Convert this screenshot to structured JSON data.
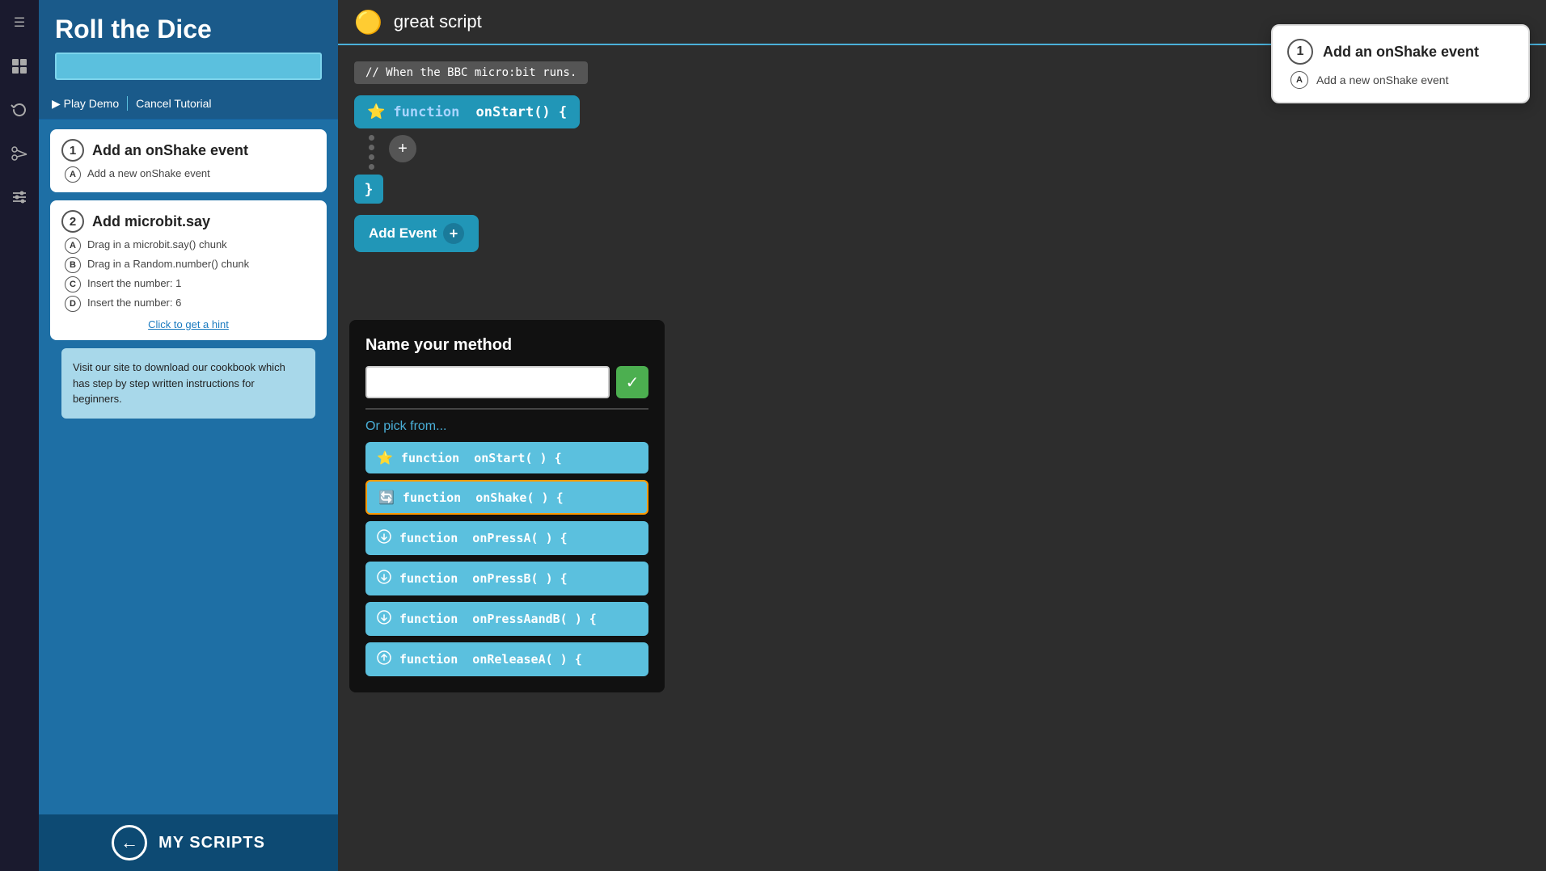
{
  "app": {
    "title": "Roll the Dice"
  },
  "icon_bar": {
    "items": [
      {
        "name": "menu-icon",
        "symbol": "☰"
      },
      {
        "name": "blocks-icon",
        "symbol": "⬛"
      },
      {
        "name": "refresh-icon",
        "symbol": "↻"
      },
      {
        "name": "scissors-icon",
        "symbol": "✂"
      },
      {
        "name": "sliders-icon",
        "symbol": "⚙"
      }
    ]
  },
  "sidebar": {
    "title": "Roll the Dice",
    "search_placeholder": "",
    "play_demo_label": "▶ Play Demo",
    "cancel_tutorial_label": "Cancel Tutorial",
    "steps": [
      {
        "number": "1",
        "title": "Add an onShake event",
        "sub_steps": [
          {
            "label": "A",
            "text": "Add a new onShake event"
          }
        ]
      },
      {
        "number": "2",
        "title": "Add microbit.say",
        "sub_steps": [
          {
            "label": "A",
            "text": "Drag in a microbit.say() chunk"
          },
          {
            "label": "B",
            "text": "Drag in a Random.number() chunk"
          },
          {
            "label": "C",
            "text": "Insert the number: 1"
          },
          {
            "label": "D",
            "text": "Insert the number: 6"
          }
        ],
        "hint": "Click to get a hint"
      }
    ],
    "info_box_text": "Visit our site to download our cookbook which has step by step written instructions for beginners.",
    "my_scripts_label": "MY SCRIPTS"
  },
  "top_bar": {
    "script_icon": "🟡",
    "script_name": "great script"
  },
  "code_area": {
    "comment": "// When the BBC micro:bit runs.",
    "function_start": "function onStart() {",
    "function_keyword": "function",
    "function_name": "onStart",
    "closing_brace": "}",
    "add_event_label": "Add Event",
    "add_event_plus": "+"
  },
  "method_modal": {
    "title": "Name your method",
    "input_placeholder": "",
    "confirm_checkmark": "✓",
    "or_pick_label": "Or pick from...",
    "options": [
      {
        "icon": "⭐",
        "text": "function  onStart( ) {",
        "highlighted": false
      },
      {
        "icon": "🔄",
        "text": "function  onShake( ) {",
        "highlighted": true
      },
      {
        "icon": "⬇",
        "text": "function  onPressA( ) {",
        "highlighted": false
      },
      {
        "icon": "⬇",
        "text": "function  onPressB( ) {",
        "highlighted": false
      },
      {
        "icon": "⬇",
        "text": "function  onPressAandB( ) {",
        "highlighted": false
      },
      {
        "icon": "⬆",
        "text": "function  onReleaseA( ) {",
        "highlighted": false
      }
    ]
  },
  "tooltip": {
    "number": "1",
    "title": "Add an onShake event",
    "sub_label": "A",
    "sub_text": "Add a new onShake event"
  }
}
